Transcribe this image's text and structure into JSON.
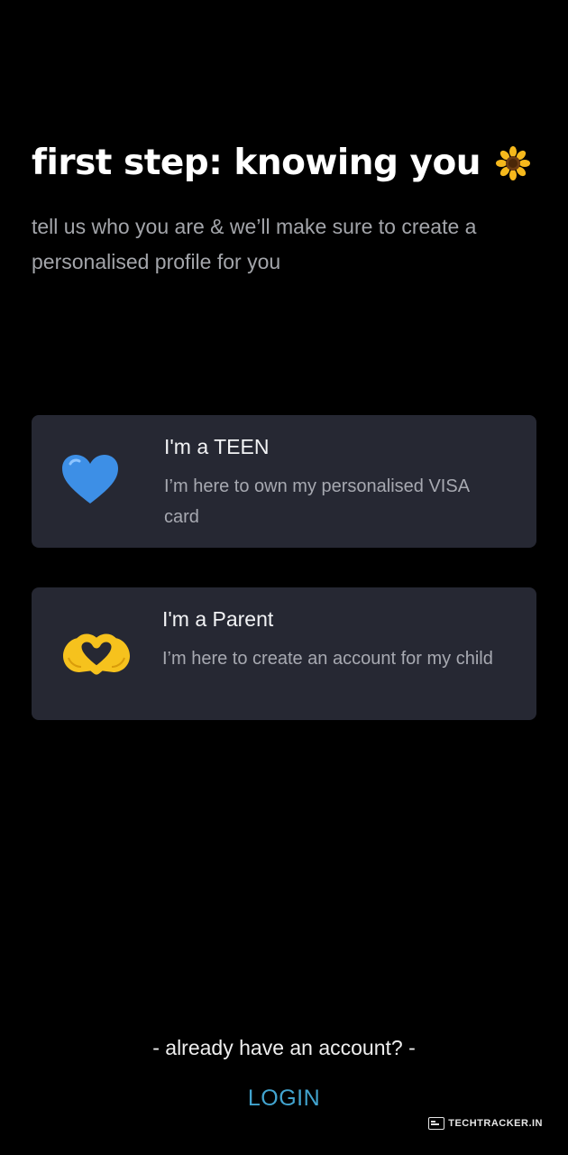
{
  "header": {
    "title": "first step: knowing you",
    "title_icon": "sunflower-icon",
    "subtitle": "tell us who you are & we’ll make sure to create a personalised profile for you"
  },
  "options": {
    "teen": {
      "icon": "blue-heart-icon",
      "title": "I'm a TEEN",
      "description": "I’m here to own my personalised VISA card"
    },
    "parent": {
      "icon": "heart-hands-icon",
      "title": "I'm a Parent",
      "description": "I’m here to create an account for my child"
    }
  },
  "footer": {
    "prompt": "- already have an account? -",
    "login_label": "LOGIN"
  },
  "watermark": {
    "text": "TECHTRACKER.IN"
  },
  "colors": {
    "background": "#000000",
    "card": "#262833",
    "login": "#42a4cf",
    "subtitle": "#a3a5aa"
  }
}
